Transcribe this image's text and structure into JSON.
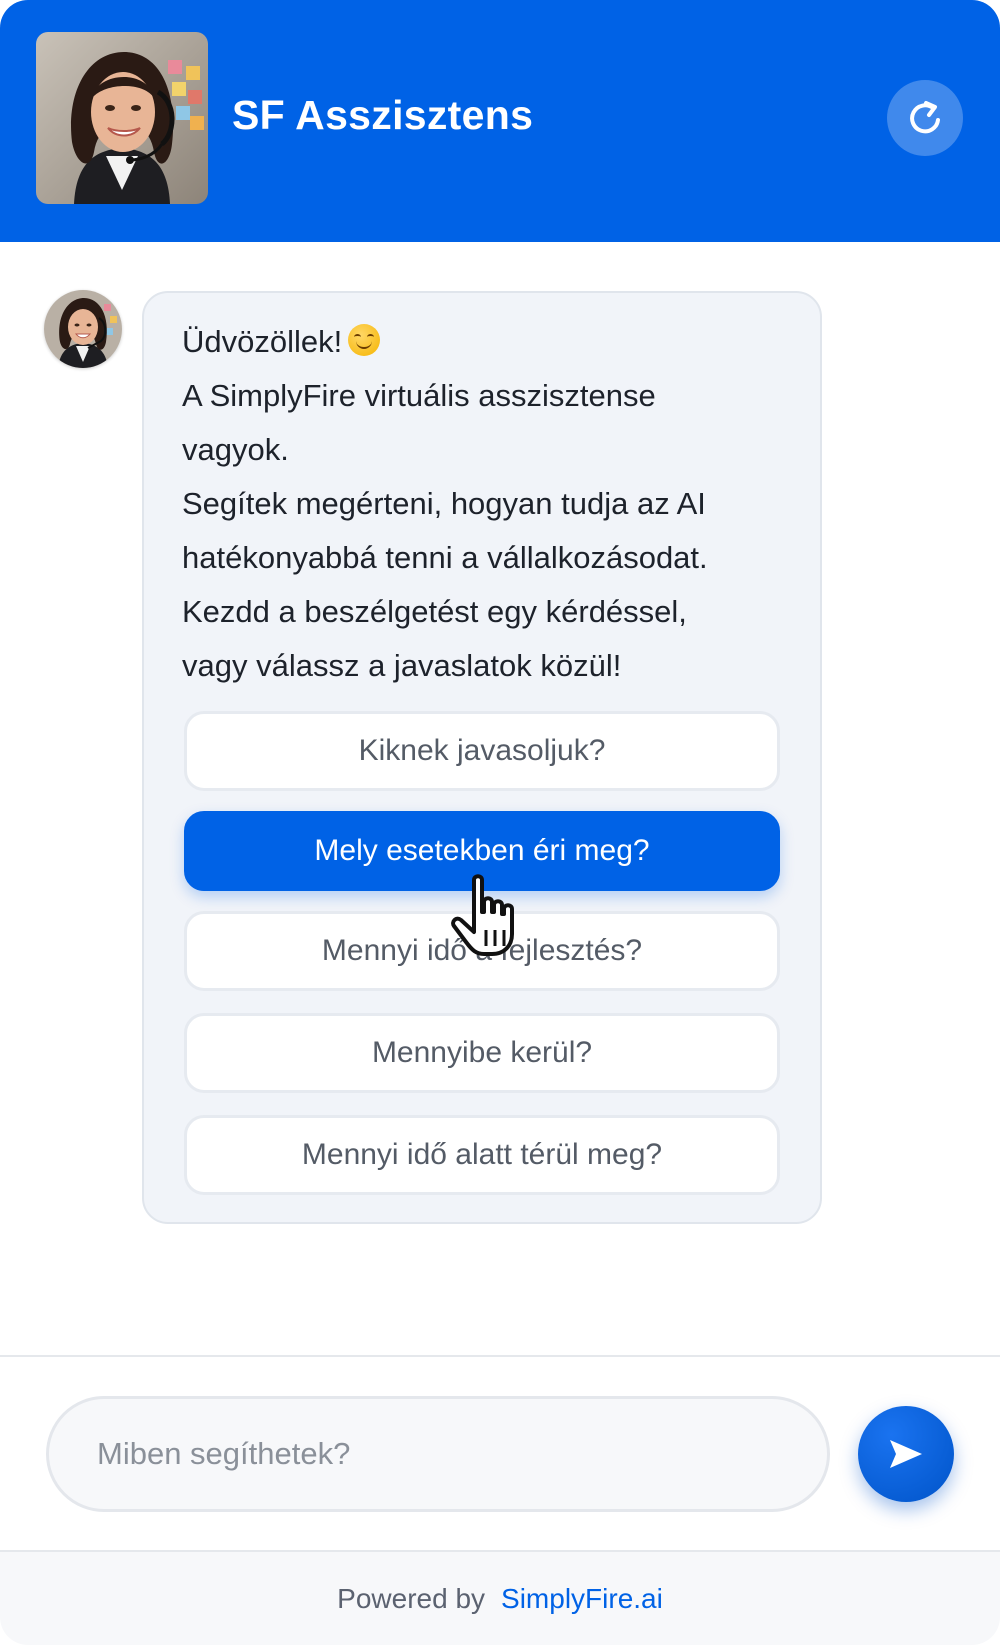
{
  "header": {
    "title": "SF Asszisztens",
    "avatar_icon": "agent-avatar-photo",
    "refresh_icon": "refresh-icon"
  },
  "message": {
    "lines": [
      "Üdvözöllek!",
      "A SimplyFire virtuális asszisztense",
      "vagyok.",
      "Segítek megérteni, hogyan tudja az AI",
      "hatékonyabbá tenni a vállalkozásodat.",
      "Kezdd a beszélgetést egy kérdéssel,",
      "vagy válassz a javaslatok közül!"
    ],
    "emoji": "smiling-face-emoji"
  },
  "suggestions": [
    {
      "label": "Kiknek javasoljuk?",
      "active": false
    },
    {
      "label": "Mely esetekben éri meg?",
      "active": true
    },
    {
      "label": "Mennyi idő a fejlesztés?",
      "active": false
    },
    {
      "label": "Mennyibe kerül?",
      "active": false
    },
    {
      "label": "Mennyi idő alatt térül meg?",
      "active": false
    }
  ],
  "input": {
    "placeholder": "Miben segíthetek?",
    "value": ""
  },
  "send_icon": "send-icon",
  "footer": {
    "powered_by": "Powered by",
    "brand": "SimplyFire.ai"
  },
  "colors": {
    "primary": "#0062e6",
    "bubble_bg": "#f1f4f9",
    "text": "#1d222b"
  }
}
